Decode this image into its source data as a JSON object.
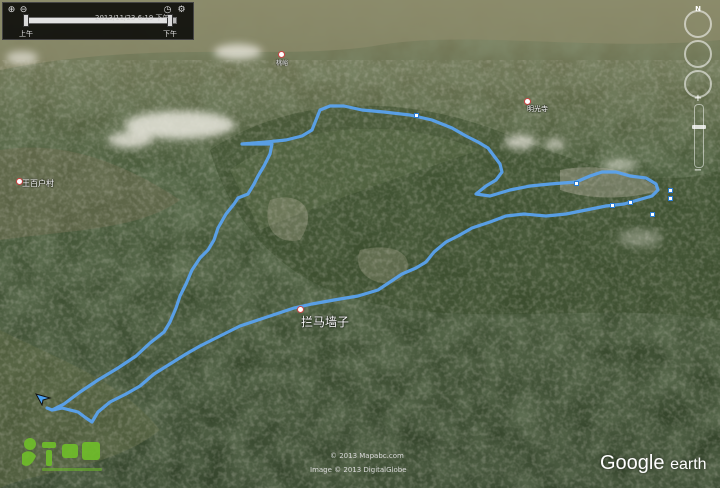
{
  "time_slider": {
    "timestamp": "2013/11/23  6:19 下午",
    "left_label": "上午",
    "right_label": "下午",
    "icons": [
      "zoom-in-icon",
      "zoom-out-icon",
      "clock-icon",
      "wrench-icon"
    ]
  },
  "places": {
    "main": "拦马墙子",
    "temple": "明光寺",
    "village": "王百户村",
    "top_label": "桃峪"
  },
  "attribution": {
    "mapabc": "© 2013 Mapabc.com",
    "image": "Image © 2013 DigitalGlobe"
  },
  "logo": {
    "google": "Google",
    "earth": "earth"
  },
  "nav": {
    "compass_label": "N"
  },
  "colors": {
    "track": "#5aa2ee",
    "terrain_dark": "#2f4226",
    "terrain_mid": "#4a5e37",
    "valley": "#7a7a5a"
  }
}
